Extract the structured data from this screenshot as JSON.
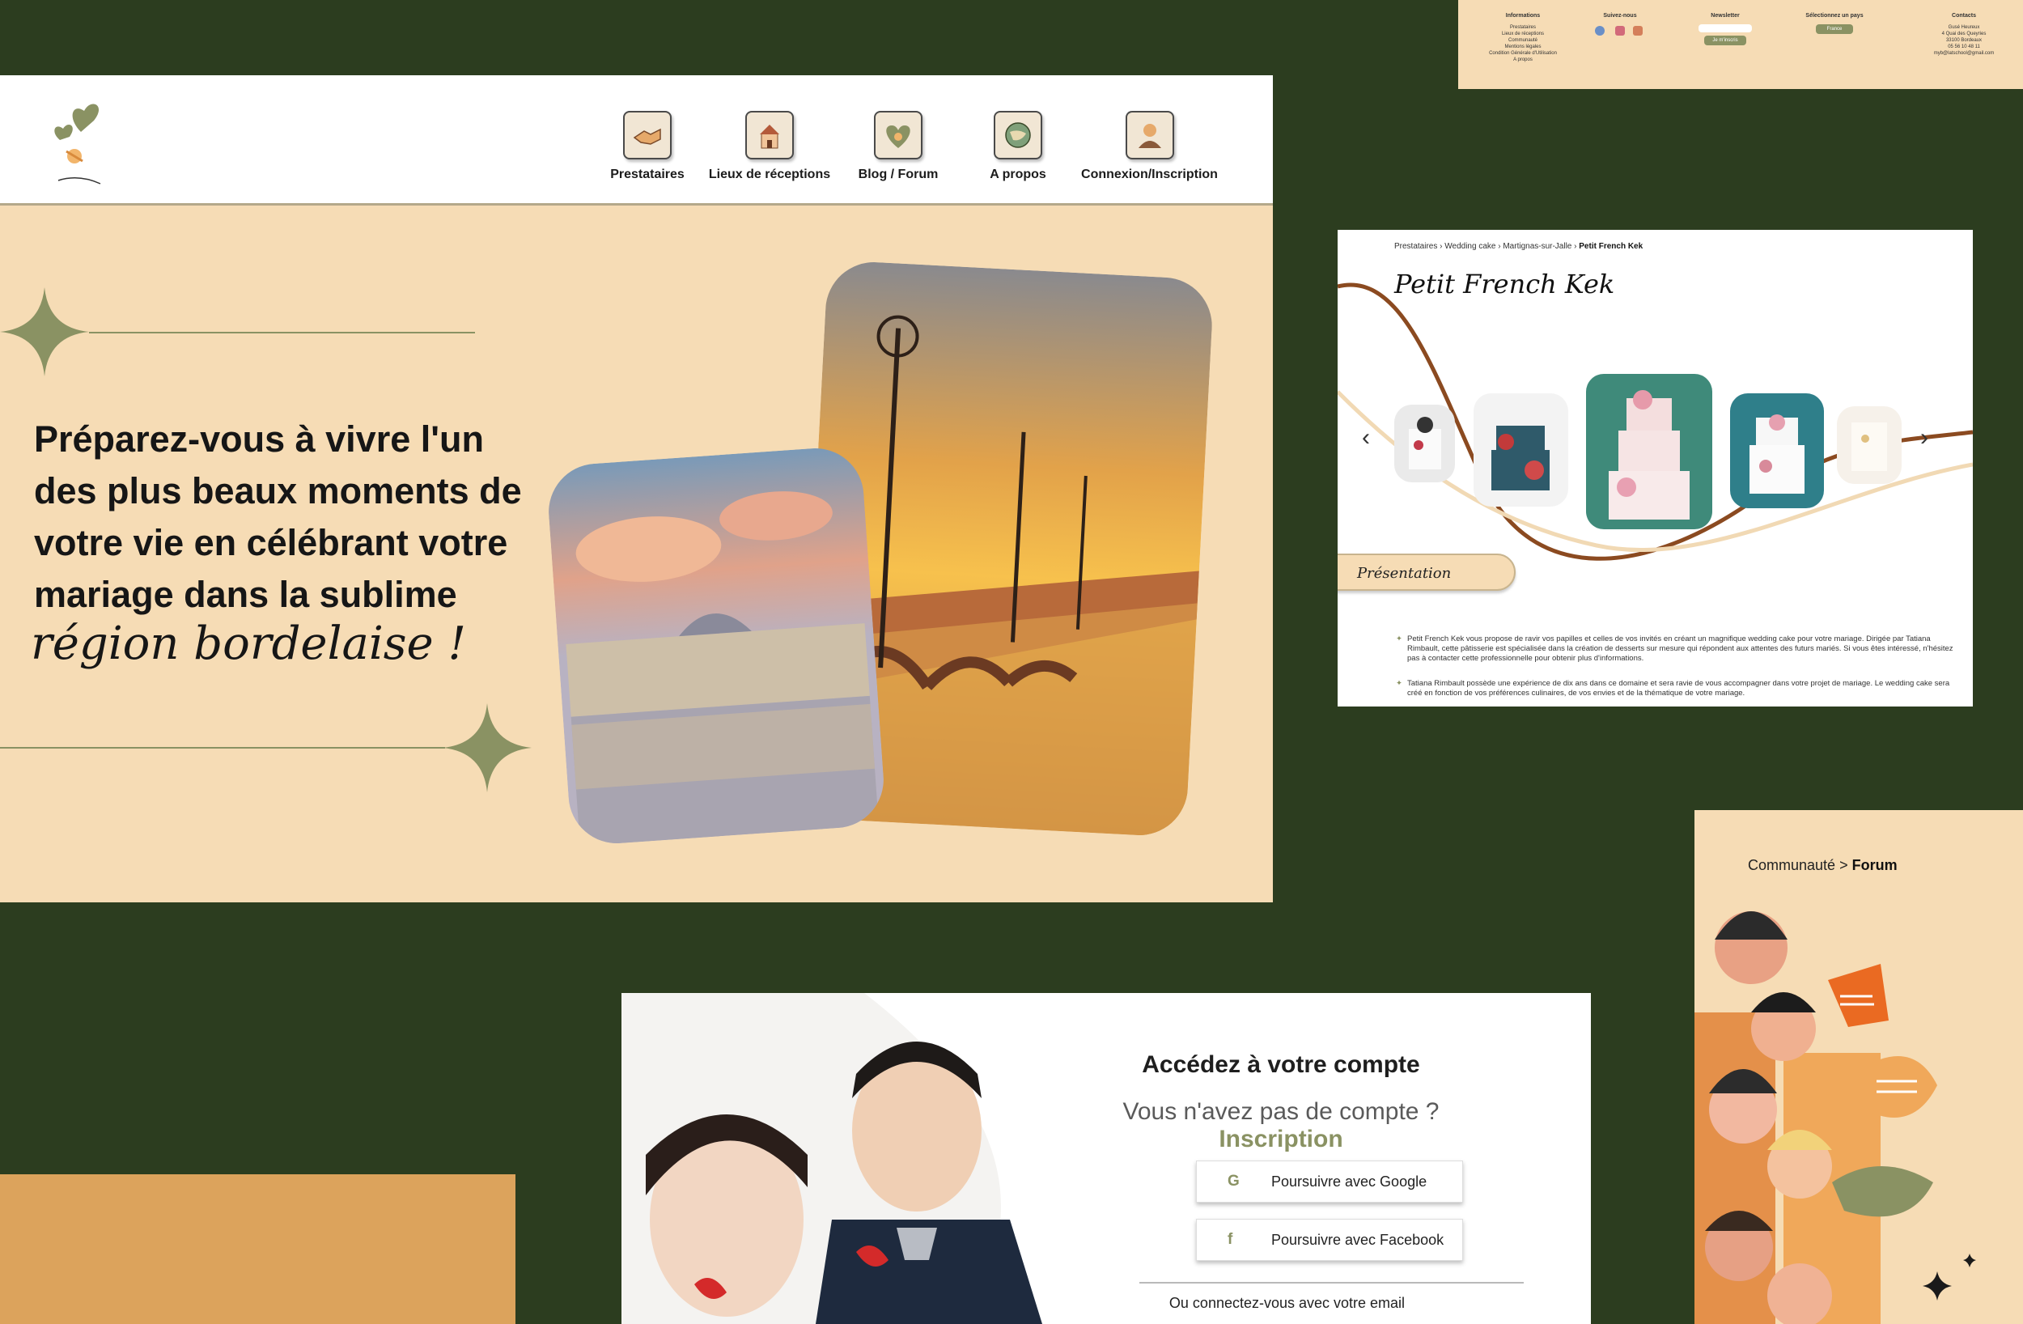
{
  "hero": {
    "nav": [
      {
        "label": "Prestataires",
        "icon": "handshake-icon"
      },
      {
        "label": "Lieux de réceptions",
        "icon": "chapel-icon"
      },
      {
        "label": "Blog / Forum",
        "icon": "heart-icon"
      },
      {
        "label": "A propos",
        "icon": "globe-icon"
      },
      {
        "label": "Connexion/Inscription",
        "icon": "user-icon"
      }
    ],
    "headline": "Préparez-vous à vivre l'un des plus beaux moments de votre vie en célébrant votre mariage dans la sublime",
    "headline_script": "région bordelaise !"
  },
  "footer": {
    "informations": {
      "title": "Informations",
      "links": [
        "Prestataires",
        "Lieux de réceptions",
        "Communauté",
        "Mentions légales",
        "Condition Générale d'Utilisation",
        "A propos"
      ]
    },
    "follow": {
      "title": "Suivez-nous"
    },
    "newsletter": {
      "title": "Newsletter",
      "button": "Je m'inscris"
    },
    "country": {
      "title": "Sélectionnez un pays",
      "value": "France"
    },
    "contacts": {
      "title": "Contacts",
      "lines": [
        "Gusé Heureux",
        "4 Quai des Queyries",
        "33100 Bordeaux",
        "05 56 10 48 11",
        "myb@latschool@gmail.com"
      ]
    }
  },
  "vendor": {
    "breadcrumb": [
      "Prestataires",
      "Wedding cake",
      "Martignas-sur-Jalle"
    ],
    "breadcrumb_current": "Petit French Kek",
    "title": "Petit French Kek",
    "prev_arrow": "‹",
    "next_arrow": "›",
    "section_tab": "Présentation",
    "paragraphs": [
      "Petit French Kek vous propose de ravir vos papilles et celles de vos invités en créant un magnifique wedding cake pour votre mariage. Dirigée par Tatiana Rimbault, cette pâtisserie est spécialisée dans la création de desserts sur mesure qui répondent aux attentes des futurs mariés. Si vous êtes intéressé, n'hésitez pas à contacter cette professionnelle pour obtenir plus d'informations.",
      "Tatiana Rimbault possède une expérience de dix ans dans ce domaine et sera ravie de vous accompagner dans votre projet de mariage. Le wedding cake sera créé en fonction de vos préférences culinaires, de vos envies et de la thématique de votre mariage."
    ]
  },
  "login": {
    "title": "Accédez à votre compte",
    "subtitle": "Vous n'avez pas de compte ?",
    "signup_link": "Inscription",
    "google_label": "Poursuivre avec Google",
    "facebook_label": "Poursuivre avec Facebook",
    "email_label": "Ou connectez-vous avec votre email"
  },
  "forum": {
    "crumb_parent": "Communauté",
    "crumb_separator": ">",
    "crumb_current": "Forum"
  },
  "colors": {
    "background": "#2c3d1f",
    "cream": "#f6dcb5",
    "olive": "#8a9263",
    "orange": "#dca35c"
  }
}
